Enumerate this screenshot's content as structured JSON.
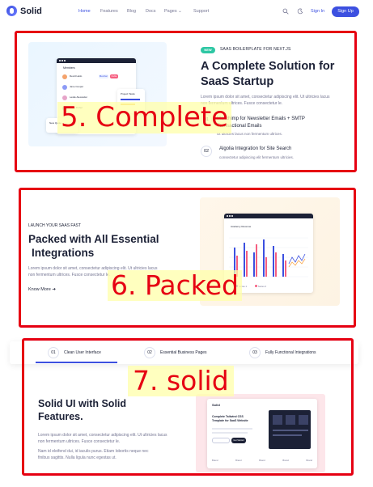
{
  "nav": {
    "logo": "Solid",
    "items": [
      "Home",
      "Features",
      "Blog",
      "Docs",
      "Pages",
      "Support"
    ],
    "active": "Home",
    "signin": "Sign In",
    "signup": "Sign Up"
  },
  "section5": {
    "badge": "NEW",
    "tag": "SAAS BOILERPLATE FOR NEXT.JS",
    "title_line1": "A Complete Solution for",
    "title_line2": "SaaS Startup",
    "desc_line1": "Lorem ipsum dolor sit amet, consectetur adipiscing elit. Ut ultricies lacus",
    "desc_line2": "non fermentum ultrices. Fusce consectetur le.",
    "features": [
      {
        "num": "01",
        "title_line1": "Mailchimp for Newsletter Emails + SMTP",
        "title_line2": "Transactional Emails",
        "desc": "Ut ultricies lacus non fermentum ultrices."
      },
      {
        "num": "02",
        "title_line1": "Algolia Integration for Site Search",
        "title_line2": "",
        "desc": "consectetur adipiscing elit fermentum ultricies."
      }
    ],
    "overlay": "5. Complete",
    "mock": {
      "header": "Members",
      "users": [
        "Devid Heilo",
        "Jane Cooper",
        "Leslie Alexander",
        "Cody Fisher"
      ],
      "roles": [
        "Member",
        "Member",
        "Admin",
        "Member"
      ],
      "action": "Invite",
      "card_title": "Project Tasks",
      "card_label": "New Quote"
    }
  },
  "section6": {
    "tag": "LAUNCH YOUR SAAS FAST",
    "title_line1": "Packed with All Essential",
    "title_line2": "Integrations",
    "desc_line1": "Lorem ipsum dolor sit amet, consectetur adipiscing elit. Ut ultricies lacus",
    "desc_line2": "non fermentum ultrices. Fusce consectetur le.",
    "link": "Know More",
    "overlay": "6. Packed",
    "mock": {
      "chart_title": "Academy Revenue",
      "legend": [
        "Series 1",
        "Series 2"
      ]
    }
  },
  "section7": {
    "tabs": [
      {
        "num": "01",
        "label": "Clean User Interface"
      },
      {
        "num": "02",
        "label": "Essential Business Pages"
      },
      {
        "num": "03",
        "label": "Fully Functional Integrations"
      }
    ],
    "title_line1": "Solid UI with Solid",
    "title_line2": "Features.",
    "desc_line1": "Lorem ipsum dolor sit amet, consectetur adipiscing elit. Ut ultricies lacus",
    "desc_line2": "non fermentum ultrices. Fusce consectetur le.",
    "desc_line3": "Nam id eleifend dui, id iaculis purus. Etiam lobortis neque nec",
    "desc_line4": "finibus sagittis. Nulla ligula nunc egestas ut.",
    "overlay": "7. solid",
    "mock": {
      "logo": "Solid",
      "heading_line1": "Complete Tailwind CSS",
      "heading_line2": "Template for SaaS Website",
      "button": "Get Started",
      "brands": [
        "Brand",
        "Brand",
        "Brand",
        "Brand",
        "Brand"
      ]
    }
  },
  "colors": {
    "accent": "#3c50e0",
    "annotation_red": "#e60012",
    "badge_green": "#2ec7a4"
  }
}
